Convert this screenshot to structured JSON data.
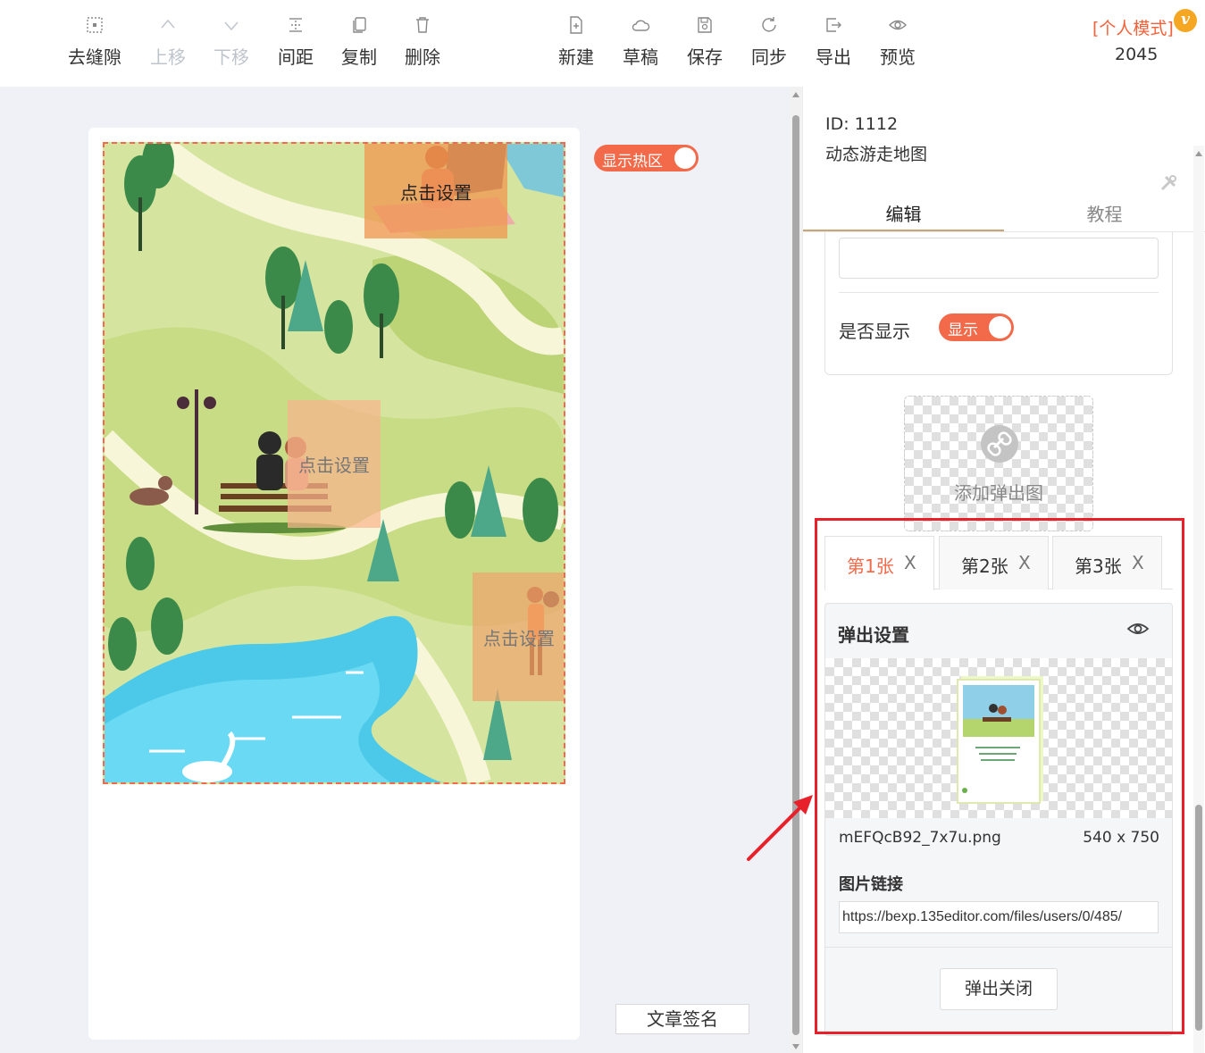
{
  "toolbar": {
    "left_items": [
      {
        "label": "去缝隙",
        "icon": "gap-remove-icon",
        "enabled": true
      },
      {
        "label": "上移",
        "icon": "chevron-up-icon",
        "enabled": false
      },
      {
        "label": "下移",
        "icon": "chevron-down-icon",
        "enabled": false
      },
      {
        "label": "间距",
        "icon": "spacing-icon",
        "enabled": true
      },
      {
        "label": "复制",
        "icon": "copy-icon",
        "enabled": true
      },
      {
        "label": "删除",
        "icon": "trash-icon",
        "enabled": true
      }
    ],
    "right_items": [
      {
        "label": "新建",
        "icon": "new-file-icon"
      },
      {
        "label": "草稿",
        "icon": "cloud-icon"
      },
      {
        "label": "保存",
        "icon": "save-icon"
      },
      {
        "label": "同步",
        "icon": "sync-icon"
      },
      {
        "label": "导出",
        "icon": "export-icon"
      },
      {
        "label": "预览",
        "icon": "eye-icon"
      }
    ],
    "mode_label": "[个人模式]",
    "vip_badge": "v",
    "user_count": "2045"
  },
  "canvas": {
    "hotzone_toggle_label": "显示热区",
    "hotzone_enabled": true,
    "hotspots": [
      {
        "label": "点击设置"
      },
      {
        "label": "点击设置"
      },
      {
        "label": "点击设置"
      }
    ],
    "signature_button": "文章签名"
  },
  "panel": {
    "template_id": "ID: 1112",
    "template_name": "动态游走地图",
    "tabs": [
      {
        "label": "编辑",
        "active": true
      },
      {
        "label": "教程",
        "active": false
      }
    ],
    "show_label": "是否显示",
    "show_toggle_label": "显示",
    "show_enabled": true,
    "add_popup_label": "添加弹出图",
    "popup_tabs": [
      {
        "label": "第1张",
        "close": "X",
        "active": true
      },
      {
        "label": "第2张",
        "close": "X",
        "active": false
      },
      {
        "label": "第3张",
        "close": "X",
        "active": false
      }
    ],
    "popup_settings": {
      "title": "弹出设置",
      "filename": "mEFQcB92_7x7u.png",
      "dimensions": "540 x 750",
      "link_label": "图片链接",
      "link_value": "https://bexp.135editor.com/files/users/0/485/",
      "close_button": "弹出关闭"
    }
  },
  "colors": {
    "accent": "#f26a4a",
    "highlight": "#e8202a",
    "canvas_bg": "#eff1f6"
  }
}
